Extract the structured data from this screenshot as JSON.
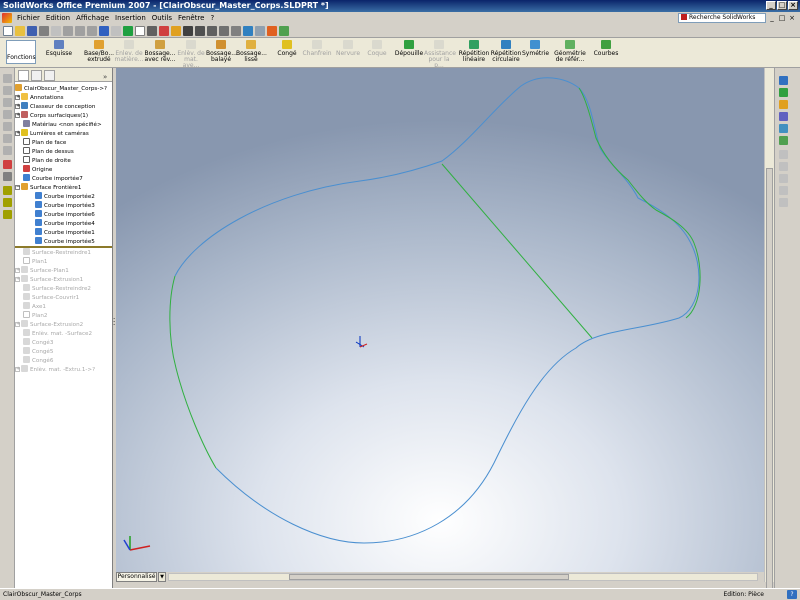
{
  "window": {
    "title": "SolidWorks Office Premium 2007 - [ClairObscur_Master_Corps.SLDPRT *]",
    "controls": [
      "_",
      "□",
      "×"
    ]
  },
  "menu": {
    "items": [
      "Fichier",
      "Edition",
      "Affichage",
      "Insertion",
      "Outils",
      "Fenêtre",
      "?"
    ],
    "search_label": "Recherche SolidWorks",
    "mdi_controls": [
      "_",
      "□",
      "×"
    ]
  },
  "commands": {
    "tab_label": "Fonctions",
    "items": [
      {
        "label": "Esquisse"
      },
      {
        "label": "Base/Bo... extrudé"
      },
      {
        "label": "Enlev. de matière..."
      },
      {
        "label": "Bossage... avec rév..."
      },
      {
        "label": "Enlèv. de mat. ave..."
      },
      {
        "label": "Bossage... balayé"
      },
      {
        "label": "Bossage... lissé"
      },
      {
        "label": "Congé"
      },
      {
        "label": "Chanfrein"
      },
      {
        "label": "Nervure"
      },
      {
        "label": "Coque"
      },
      {
        "label": "Dépouille"
      },
      {
        "label": "Assistance pour la p..."
      },
      {
        "label": "Répétition linéaire"
      },
      {
        "label": "Répétition circulaire"
      },
      {
        "label": "Symétrie"
      },
      {
        "label": "Géométrie de référ..."
      },
      {
        "label": "Courbes"
      }
    ]
  },
  "tree": {
    "root": "ClairObscur_Master_Corps->?",
    "items": [
      {
        "label": "Annotations"
      },
      {
        "label": "Classeur de conception"
      },
      {
        "label": "Corps surfaciques(1)"
      },
      {
        "label": "Matériau <non spécifié>"
      },
      {
        "label": "Lumières et caméras"
      },
      {
        "label": "Plan de face"
      },
      {
        "label": "Plan de dessus"
      },
      {
        "label": "Plan de droite"
      },
      {
        "label": "Origine"
      },
      {
        "label": "Courbe importée7"
      },
      {
        "label": "Surface Frontière1"
      },
      {
        "label": "Courbe importée2"
      },
      {
        "label": "Courbe importée3"
      },
      {
        "label": "Courbe importée6"
      },
      {
        "label": "Courbe importée4"
      },
      {
        "label": "Courbe importée1"
      },
      {
        "label": "Courbe importée5"
      },
      {
        "label": "Surface-Restreindre1"
      },
      {
        "label": "Plan1"
      },
      {
        "label": "Surface-Plan1"
      },
      {
        "label": "Surface-Extrusion1"
      },
      {
        "label": "Surface-Restreindre2"
      },
      {
        "label": "Surface-Couvrir1"
      },
      {
        "label": "Axe1"
      },
      {
        "label": "Plan2"
      },
      {
        "label": "Surface-Extrusion2"
      },
      {
        "label": "Enlèv. mat. -Surface2"
      },
      {
        "label": "Congé3"
      },
      {
        "label": "Congé5"
      },
      {
        "label": "Congé6"
      },
      {
        "label": "Enlèv. mat. -Extru.1->?"
      }
    ]
  },
  "viewport": {
    "config_tab": "Personnalisé",
    "colors": {
      "curve_blue": "#4a8fd0",
      "curve_green": "#30b040"
    }
  },
  "status": {
    "left": "ClairObscur_Master_Corps",
    "right": "Edition: Pièce",
    "help": "?"
  }
}
